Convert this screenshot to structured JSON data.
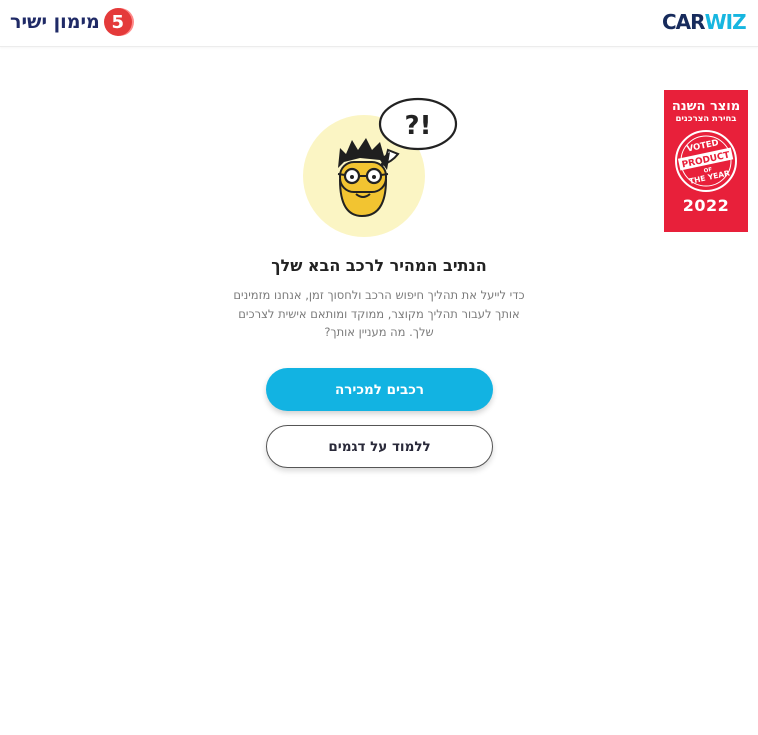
{
  "header": {
    "brand_left": {
      "number": "5",
      "text": "מימון ישיר"
    },
    "brand_right": {
      "part1": "CAR",
      "part2": "WIZ"
    }
  },
  "badge": {
    "title": "מוצר השנה",
    "subtitle": "בחירת הצרכנים",
    "stamp_top": "VOTED",
    "stamp_mid": "PRODUCT",
    "stamp_of": "OF",
    "stamp_bottom": "THE YEAR",
    "year": "2022"
  },
  "illustration": {
    "bubble_text": "?!"
  },
  "main": {
    "headline": "הנתיב המהיר לרכב הבא שלך",
    "description_lines": [
      "כדי לייעל את תהליך חיפוש הרכב ולחסוך זמן, אנחנו מזמינים",
      "אותך לעבור תהליך מקוצר, ממוקד ומותאם אישית לצרכים",
      "שלך. מה מעניין אותך?"
    ]
  },
  "buttons": {
    "primary_label": "רכבים למכירה",
    "secondary_label": "ללמוד על דגמים"
  },
  "colors": {
    "accent": "#12b3e2",
    "brand_navy": "#172b5c",
    "badge_red": "#e8203a",
    "logo_red": "#e43a3a"
  }
}
